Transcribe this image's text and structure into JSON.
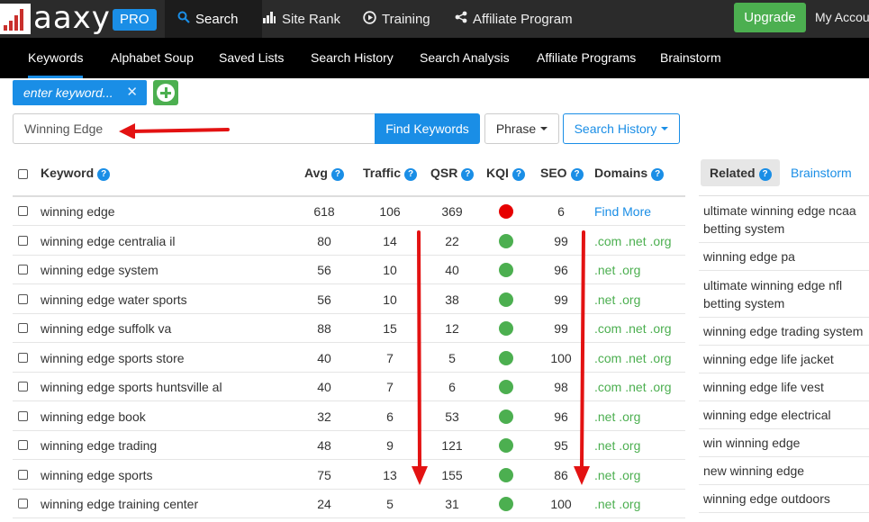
{
  "brand": {
    "logo_text": "aaxy",
    "pro_badge": "PRO"
  },
  "topnav": {
    "search": "Search",
    "site_rank": "Site Rank",
    "training": "Training",
    "affiliate": "Affiliate Program",
    "upgrade": "Upgrade",
    "my_account": "My Accou"
  },
  "subnav": [
    "Keywords",
    "Alphabet Soup",
    "Saved Lists",
    "Search History",
    "Search Analysis",
    "Affiliate Programs",
    "Brainstorm"
  ],
  "chip": {
    "placeholder": "enter keyword...",
    "close": "✕"
  },
  "search": {
    "value": "Winning Edge",
    "find_button": "Find Keywords",
    "phrase_button": "Phrase",
    "history_button": "Search History"
  },
  "table": {
    "headers": {
      "keyword": "Keyword",
      "avg": "Avg",
      "traffic": "Traffic",
      "qsr": "QSR",
      "kqi": "KQI",
      "seo": "SEO",
      "domains": "Domains"
    },
    "rows": [
      {
        "keyword": "winning edge",
        "avg": "618",
        "traffic": "106",
        "qsr": "369",
        "kqi": "red",
        "seo": "6",
        "domains": "Find More"
      },
      {
        "keyword": "winning edge centralia il",
        "avg": "80",
        "traffic": "14",
        "qsr": "22",
        "kqi": "green",
        "seo": "99",
        "domains": ".com .net .org"
      },
      {
        "keyword": "winning edge system",
        "avg": "56",
        "traffic": "10",
        "qsr": "40",
        "kqi": "green",
        "seo": "96",
        "domains": ".net .org"
      },
      {
        "keyword": "winning edge water sports",
        "avg": "56",
        "traffic": "10",
        "qsr": "38",
        "kqi": "green",
        "seo": "99",
        "domains": ".net .org"
      },
      {
        "keyword": "winning edge suffolk va",
        "avg": "88",
        "traffic": "15",
        "qsr": "12",
        "kqi": "green",
        "seo": "99",
        "domains": ".com .net .org"
      },
      {
        "keyword": "winning edge sports store",
        "avg": "40",
        "traffic": "7",
        "qsr": "5",
        "kqi": "green",
        "seo": "100",
        "domains": ".com .net .org"
      },
      {
        "keyword": "winning edge sports huntsville al",
        "avg": "40",
        "traffic": "7",
        "qsr": "6",
        "kqi": "green",
        "seo": "98",
        "domains": ".com .net .org"
      },
      {
        "keyword": "winning edge book",
        "avg": "32",
        "traffic": "6",
        "qsr": "53",
        "kqi": "green",
        "seo": "96",
        "domains": ".net .org"
      },
      {
        "keyword": "winning edge trading",
        "avg": "48",
        "traffic": "9",
        "qsr": "121",
        "kqi": "green",
        "seo": "95",
        "domains": ".net .org"
      },
      {
        "keyword": "winning edge sports",
        "avg": "75",
        "traffic": "13",
        "qsr": "155",
        "kqi": "green",
        "seo": "86",
        "domains": ".net .org"
      },
      {
        "keyword": "winning edge training center",
        "avg": "24",
        "traffic": "5",
        "qsr": "31",
        "kqi": "green",
        "seo": "100",
        "domains": ".net .org"
      }
    ]
  },
  "related": {
    "tab_related": "Related",
    "tab_brainstorm": "Brainstorm",
    "items": [
      "ultimate winning edge ncaa betting system",
      "winning edge pa",
      "ultimate winning edge nfl betting system",
      "winning edge trading system",
      "winning edge life jacket",
      "winning edge life vest",
      "winning edge electrical",
      "win winning edge",
      "new winning edge",
      "winning edge outdoors"
    ]
  },
  "colors": {
    "accent": "#1a8ee6",
    "green": "#4caf50",
    "red": "#e60000",
    "annotation_arrow": "#e31212"
  }
}
